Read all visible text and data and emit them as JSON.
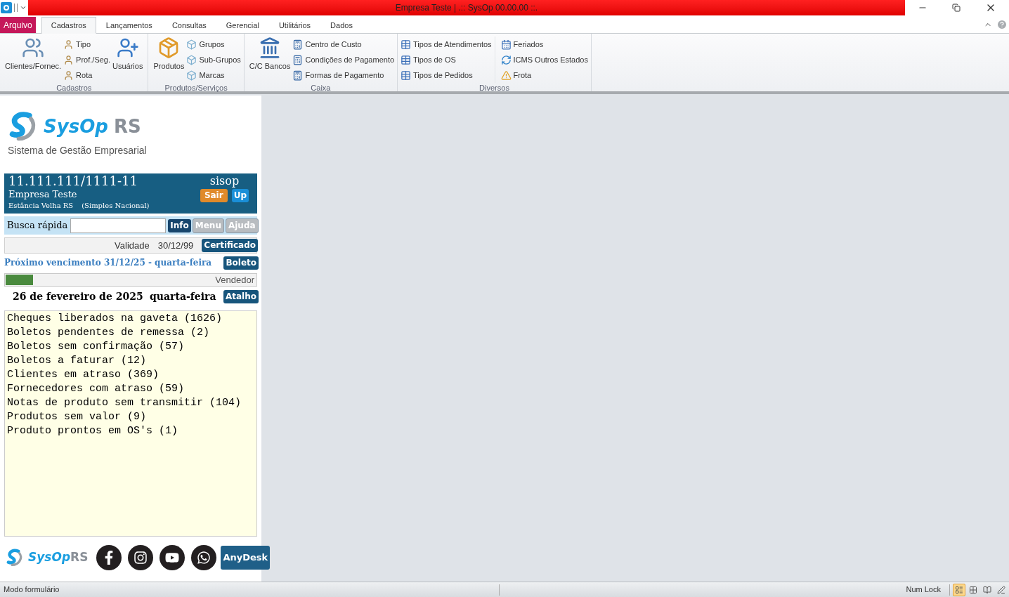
{
  "window": {
    "title": "Empresa Teste | .:: SysOp 00.00.00 ::."
  },
  "ribbon_tabs": [
    {
      "label": "Arquivo",
      "kind": "file",
      "selected": false
    },
    {
      "label": "Cadastros",
      "kind": "tab",
      "selected": true
    },
    {
      "label": "Lançamentos",
      "kind": "tab",
      "selected": false
    },
    {
      "label": "Consultas",
      "kind": "tab",
      "selected": false
    },
    {
      "label": "Gerencial",
      "kind": "tab",
      "selected": false
    },
    {
      "label": "Utilitários",
      "kind": "tab",
      "selected": false
    },
    {
      "label": "Dados",
      "kind": "tab",
      "selected": false
    }
  ],
  "ribbon_groups": [
    {
      "label": "Cadastros",
      "items": [
        {
          "label": "Clientes/Fornec.",
          "kind": "large"
        },
        {
          "label": "Tipo",
          "kind": "small"
        },
        {
          "label": "Prof./Seg.",
          "kind": "small"
        },
        {
          "label": "Rota",
          "kind": "small"
        },
        {
          "label": "Usuários",
          "kind": "large"
        }
      ]
    },
    {
      "label": "Produtos/Serviços",
      "items": [
        {
          "label": "Produtos",
          "kind": "large"
        },
        {
          "label": "Grupos",
          "kind": "small"
        },
        {
          "label": "Sub-Grupos",
          "kind": "small"
        },
        {
          "label": "Marcas",
          "kind": "small"
        }
      ]
    },
    {
      "label": "Caixa",
      "items": [
        {
          "label": "C/C Bancos",
          "kind": "large"
        },
        {
          "label": "Centro de Custo",
          "kind": "small"
        },
        {
          "label": "Condições de Pagamento",
          "kind": "small"
        },
        {
          "label": "Formas de Pagamento",
          "kind": "small"
        }
      ]
    },
    {
      "label": "Diversos",
      "items": [
        {
          "label": "Tipos de Atendimentos",
          "kind": "small"
        },
        {
          "label": "Tipos de OS",
          "kind": "small"
        },
        {
          "label": "Tipos de Pedidos",
          "kind": "small"
        },
        {
          "label": "Feriados",
          "kind": "small"
        },
        {
          "label": "ICMS Outros Estados",
          "kind": "small"
        },
        {
          "label": "Frota",
          "kind": "small"
        }
      ]
    }
  ],
  "panel": {
    "logo": {
      "name": "SysOp",
      "suffix": "RS",
      "tagline": "Sistema de Gestão Empresarial"
    },
    "company": {
      "cnpj": "11.111.111/1111-11",
      "name": "Empresa Teste",
      "city": "Estância Velha RS",
      "regime": "(Simples Nacional)",
      "user": "sisop",
      "buttons": [
        "Sair",
        "Up"
      ]
    },
    "search": {
      "label": "Busca rápida",
      "buttons": [
        {
          "label": "Info",
          "disabled": false
        },
        {
          "label": "Menu",
          "disabled": true
        },
        {
          "label": "Ajuda",
          "disabled": true
        }
      ]
    },
    "validity": {
      "label": "Validade",
      "value": "30/12/99",
      "button": "Certificado"
    },
    "due": {
      "text": "Próximo vencimento 31/12/25 - quarta-feira",
      "button": "Boleto"
    },
    "progress": {
      "level": 0.11,
      "label": "Vendedor"
    },
    "today": {
      "date": "26 de fevereiro de 2025",
      "weekday": "quarta-feira",
      "button": "Atalho"
    },
    "alerts": [
      "Cheques liberados na gaveta (1626)",
      "Boletos pendentes de remessa (2)",
      "Boletos sem confirmação (57)",
      "Boletos a faturar (12)",
      "Clientes em atraso (369)",
      "Fornecedores com atraso (59)",
      "Notas de produto sem transmitir (104)",
      "Produtos sem valor (9)",
      "Produto prontos em OS's (1)"
    ],
    "footer": {
      "logo_name": "SysOp",
      "logo_suffix": "RS",
      "remote_button": "AnyDesk"
    }
  },
  "status_bar": {
    "mode": "Modo formulário",
    "num_lock": "Num Lock",
    "views": [
      {
        "selected": true
      },
      {
        "selected": false
      },
      {
        "selected": false
      },
      {
        "selected": false
      }
    ]
  }
}
